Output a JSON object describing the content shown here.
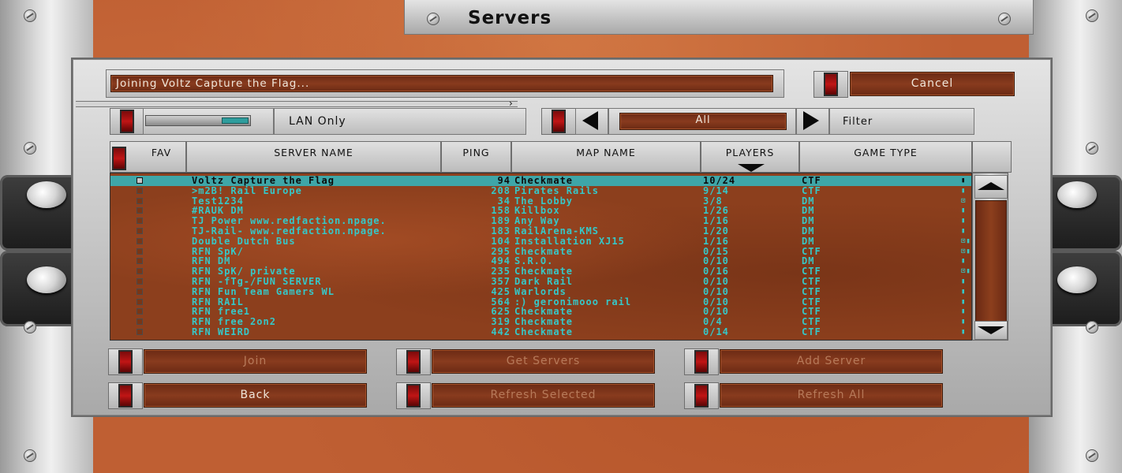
{
  "header": {
    "title": "Servers"
  },
  "status": {
    "message": "Joining Voltz Capture the Flag...",
    "cancel_label": "Cancel"
  },
  "filters": {
    "lan_only_label": "LAN Only",
    "game_type_filter": "All",
    "filter_label": "Filter"
  },
  "table": {
    "columns": [
      "FAV",
      "SERVER NAME",
      "PING",
      "MAP NAME",
      "PLAYERS",
      "GAME TYPE"
    ],
    "sorted_by": "PLAYERS",
    "rows": [
      {
        "name": "Voltz Capture the Flag",
        "ping": "94",
        "map": "Checkmate",
        "players": "10/24",
        "type": "CTF",
        "icons": "▮"
      },
      {
        "name": ">m2B! Rail Europe",
        "ping": "208",
        "map": "Pirates Rails",
        "players": "9/14",
        "type": "CTF",
        "icons": "▮"
      },
      {
        "name": "Test1234",
        "ping": "34",
        "map": "The Lobby",
        "players": "3/8",
        "type": "DM",
        "icons": "⊡"
      },
      {
        "name": "#RAUK DM",
        "ping": "158",
        "map": "Killbox",
        "players": "1/26",
        "type": "DM",
        "icons": "▮"
      },
      {
        "name": "TJ Power www.redfaction.npage.",
        "ping": "189",
        "map": "Any Way",
        "players": "1/16",
        "type": "DM",
        "icons": "▮"
      },
      {
        "name": "TJ-Rail- www.redfaction.npage.",
        "ping": "183",
        "map": "RailArena-KMS",
        "players": "1/20",
        "type": "DM",
        "icons": "▮"
      },
      {
        "name": "Double Dutch Bus",
        "ping": "104",
        "map": "Installation XJ15",
        "players": "1/16",
        "type": "DM",
        "icons": "⊡▮"
      },
      {
        "name": "RFN SpK/",
        "ping": "295",
        "map": "Checkmate",
        "players": "0/15",
        "type": "CTF",
        "icons": "⊡▮"
      },
      {
        "name": "RFN DM",
        "ping": "494",
        "map": "S.R.O.",
        "players": "0/10",
        "type": "DM",
        "icons": "▮"
      },
      {
        "name": "RFN SpK/ private",
        "ping": "235",
        "map": "Checkmate",
        "players": "0/16",
        "type": "CTF",
        "icons": "⊡▮"
      },
      {
        "name": "RFN -fTg-/FUN SERVER",
        "ping": "357",
        "map": "Dark Rail",
        "players": "0/10",
        "type": "CTF",
        "icons": "▮"
      },
      {
        "name": "RFN Fun Team Gamers WL",
        "ping": "425",
        "map": "Warlords",
        "players": "0/10",
        "type": "CTF",
        "icons": "▮"
      },
      {
        "name": "RFN RAIL",
        "ping": "564",
        "map": ":) geronimooo rail",
        "players": "0/10",
        "type": "CTF",
        "icons": "▮"
      },
      {
        "name": "RFN free1",
        "ping": "625",
        "map": "Checkmate",
        "players": "0/10",
        "type": "CTF",
        "icons": "▮"
      },
      {
        "name": "RFN free 2on2",
        "ping": "319",
        "map": "Checkmate",
        "players": "0/4",
        "type": "CTF",
        "icons": "▮"
      },
      {
        "name": "RFN WEIRD",
        "ping": "442",
        "map": "Checkmate",
        "players": "0/14",
        "type": "CTF",
        "icons": "▮"
      }
    ]
  },
  "buttons": {
    "join": "Join",
    "get_servers": "Get Servers",
    "add_server": "Add Server",
    "back": "Back",
    "refresh_selected": "Refresh Selected",
    "refresh_all": "Refresh All"
  },
  "colors": {
    "accent": "#3ea6a8",
    "rust": "#883b1e",
    "led": "#c01515"
  }
}
